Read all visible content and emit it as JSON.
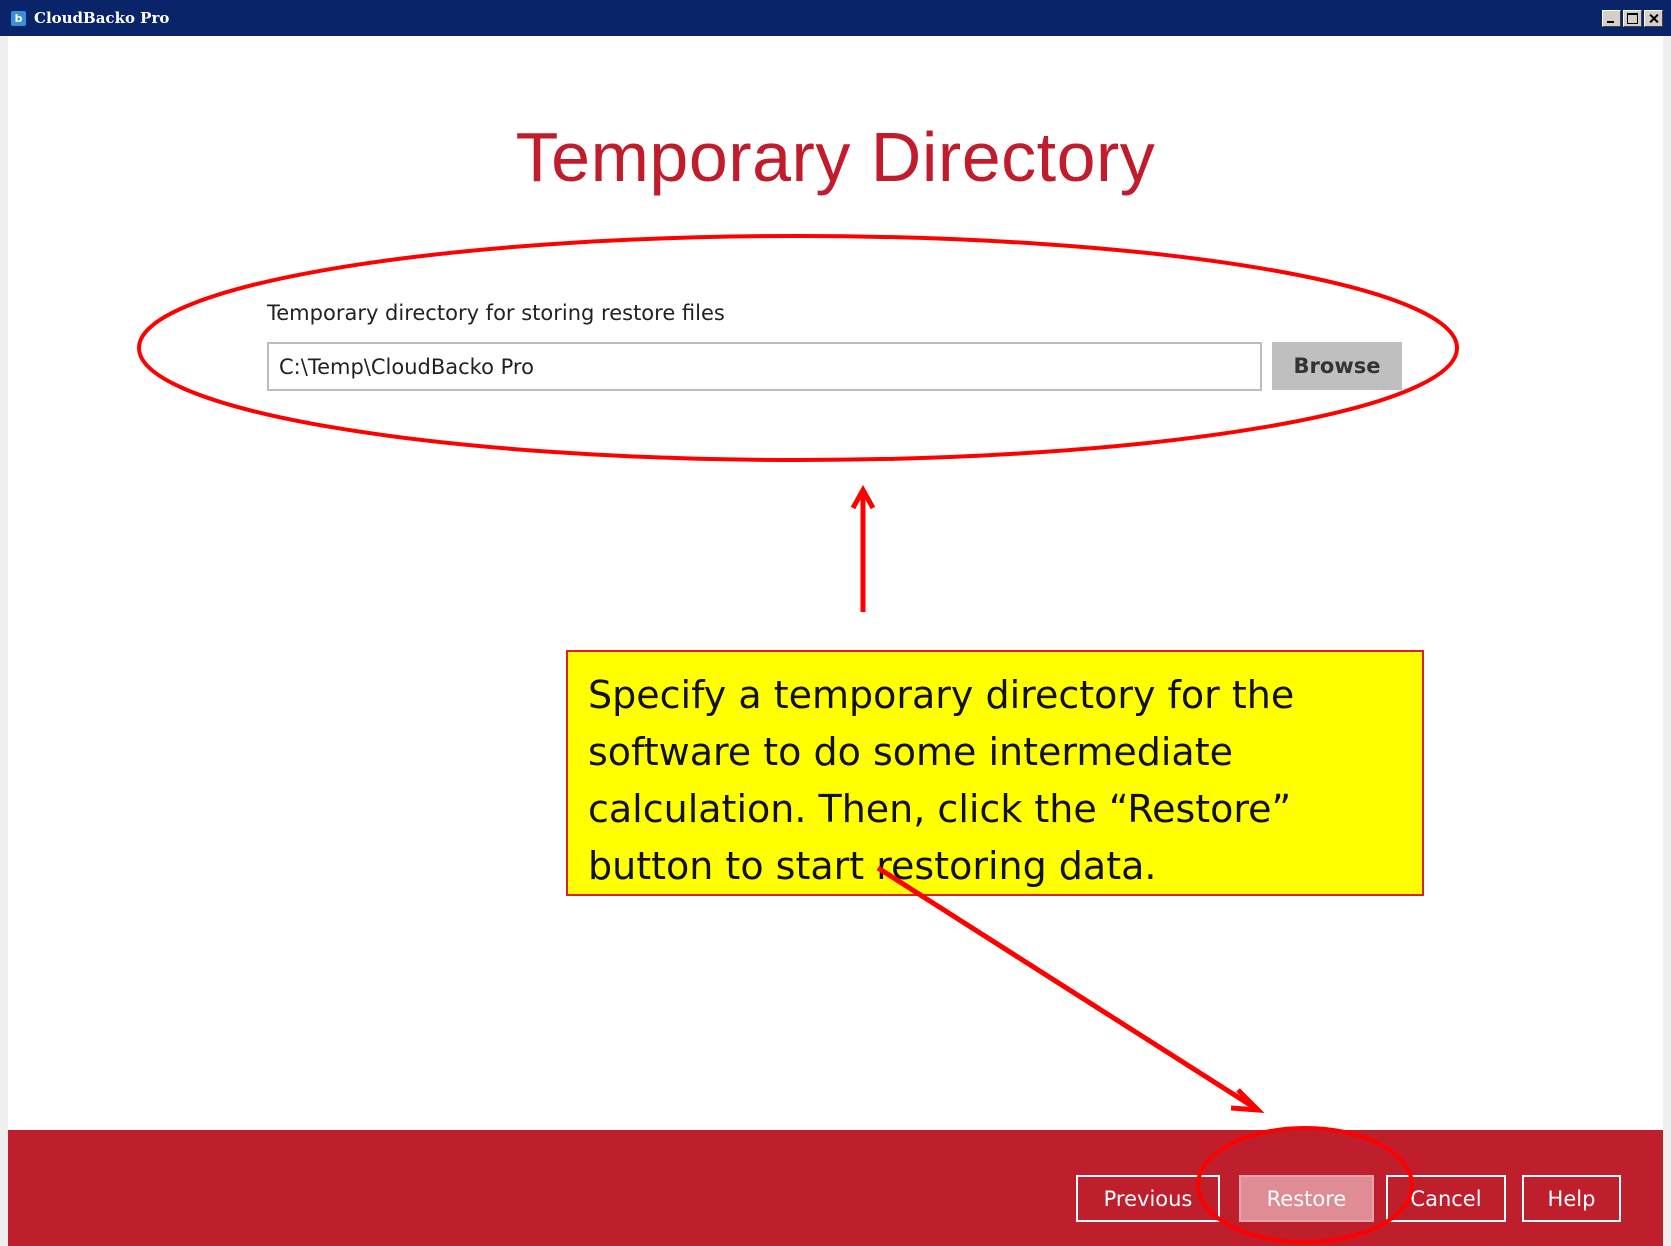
{
  "window": {
    "title": "CloudBacko Pro",
    "icon": "app-logo-icon"
  },
  "page": {
    "title": "Temporary Directory",
    "field_label": "Temporary directory for storing restore files",
    "path_value": "C:\\Temp\\CloudBacko Pro",
    "browse_label": "Browse"
  },
  "footer": {
    "previous_label": "Previous",
    "restore_label": "Restore",
    "cancel_label": "Cancel",
    "help_label": "Help"
  },
  "annotation": {
    "callout_text": "Specify a temporary directory for the software to do some intermediate calculation. Then, click the “Restore” button to start restoring data.",
    "highlight_color": "#ff0000",
    "callout_bg": "#ffff00"
  },
  "colors": {
    "brand_red": "#bf1e2d",
    "title_red": "#c01c2c",
    "titlebar_blue": "#0a246a"
  }
}
